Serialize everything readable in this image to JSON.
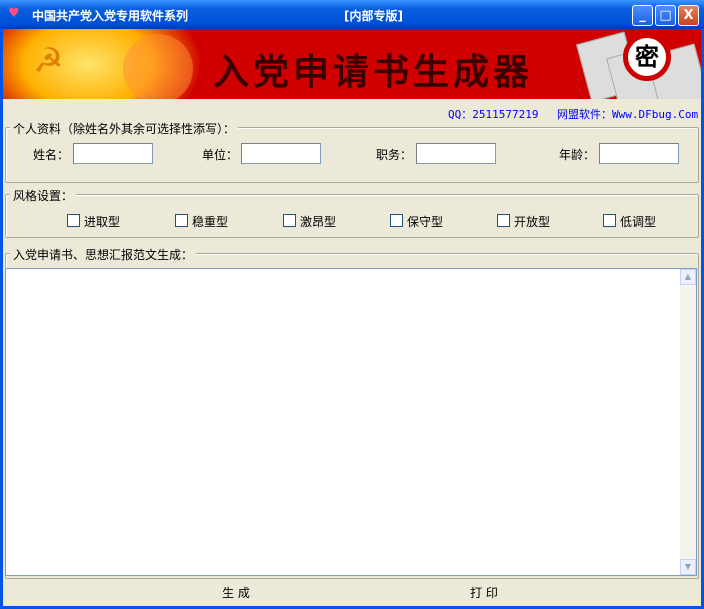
{
  "window": {
    "title": "中国共产党入党专用软件系列",
    "subtitle": "[内部专版]",
    "minimize": "_",
    "maximize": "□",
    "close": "X"
  },
  "banner": {
    "title": "入党申请书生成器",
    "stamp": "密"
  },
  "info": {
    "qq": "QQ：2511577219",
    "site": "网盟软件：Www.DFbug.Com"
  },
  "personal": {
    "legend": "个人资料（除姓名外其余可选择性添写）：",
    "fields": [
      {
        "label": "姓名：",
        "value": ""
      },
      {
        "label": "单位：",
        "value": ""
      },
      {
        "label": "职务：",
        "value": ""
      },
      {
        "label": "年龄：",
        "value": ""
      }
    ]
  },
  "style": {
    "legend": "风格设置：",
    "options": [
      {
        "label": "进取型",
        "checked": false
      },
      {
        "label": "稳重型",
        "checked": false
      },
      {
        "label": "激昂型",
        "checked": false
      },
      {
        "label": "保守型",
        "checked": false
      },
      {
        "label": "开放型",
        "checked": false
      },
      {
        "label": "低调型",
        "checked": false
      }
    ]
  },
  "output": {
    "legend": "入党申请书、思想汇报范文生成：",
    "text": ""
  },
  "buttons": {
    "generate": "生 成",
    "print": "打 印"
  }
}
